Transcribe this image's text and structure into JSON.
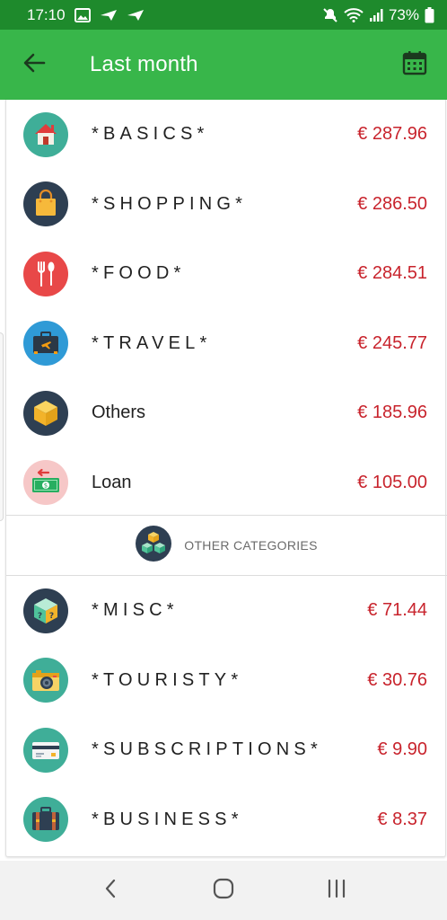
{
  "status_bar": {
    "time": "17:10",
    "battery": "73%",
    "icons": [
      "gallery-icon",
      "send-icon",
      "send-icon",
      "mute-icon",
      "wifi-icon",
      "signal-icon",
      "battery-icon"
    ]
  },
  "app_bar": {
    "title": "Last month",
    "back_icon": "arrow-back-icon",
    "calendar_icon": "calendar-icon",
    "background": "#38b64a"
  },
  "categories": [
    {
      "name": "*BASICS*",
      "amount": "€ 287.96",
      "icon": "house-icon"
    },
    {
      "name": "*SHOPPING*",
      "amount": "€ 286.50",
      "icon": "shopping-bag-icon"
    },
    {
      "name": "*FOOD*",
      "amount": "€ 284.51",
      "icon": "fork-spoon-icon"
    },
    {
      "name": "*TRAVEL*",
      "amount": "€ 245.77",
      "icon": "suitcase-plane-icon"
    },
    {
      "name": "Others",
      "amount": "€ 185.96",
      "icon": "box-icon"
    },
    {
      "name": "Loan",
      "amount": "€ 105.00",
      "icon": "banknote-icon"
    }
  ],
  "other_section": {
    "label": "OTHER CATEGORIES",
    "icon": "boxes-icon"
  },
  "other_categories": [
    {
      "name": "*MISC*",
      "amount": "€ 71.44",
      "icon": "mystery-box-icon"
    },
    {
      "name": "*TOURISTY*",
      "amount": "€ 30.76",
      "icon": "camera-icon"
    },
    {
      "name": "*SUBSCRIPTIONS*",
      "amount": "€ 9.90",
      "icon": "credit-card-icon"
    },
    {
      "name": "*BUSINESS*",
      "amount": "€ 8.37",
      "icon": "briefcase-icon"
    }
  ],
  "colors": {
    "status_bar": "#1e8a2c",
    "app_bar": "#38b64a",
    "amount": "#c8232c"
  },
  "nav_bar": {
    "icons": [
      "nav-back-icon",
      "nav-home-icon",
      "nav-recents-icon"
    ]
  }
}
